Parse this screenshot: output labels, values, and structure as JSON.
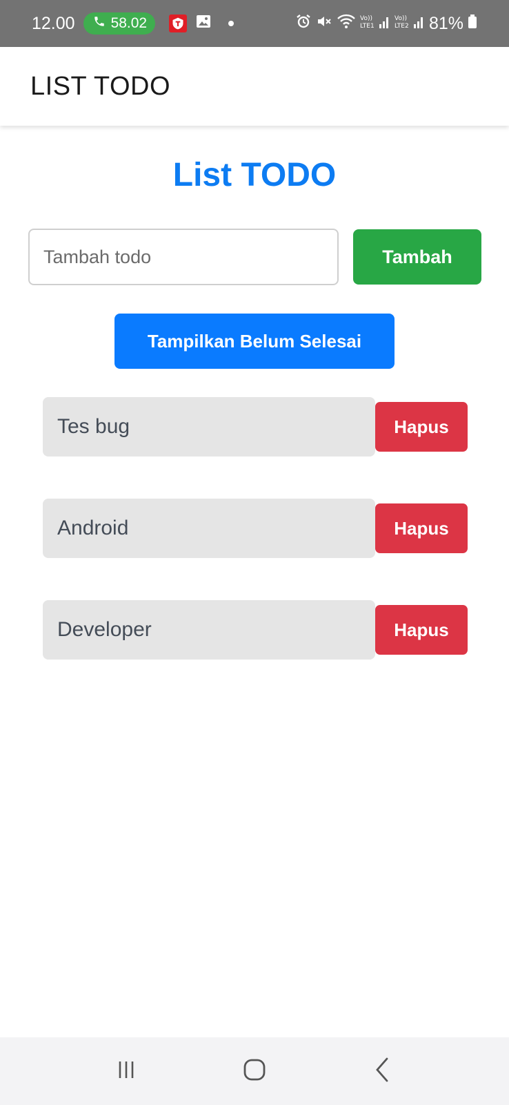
{
  "status_bar": {
    "time": "12.00",
    "call_timer": "58.02",
    "battery": "81%"
  },
  "app_bar": {
    "title": "LIST TODO"
  },
  "main": {
    "heading": "List TODO",
    "input_placeholder": "Tambah todo",
    "input_value": "",
    "add_button": "Tambah",
    "filter_button": "Tampilkan Belum Selesai",
    "todos": [
      {
        "text": "Tes bug",
        "delete_label": "Hapus"
      },
      {
        "text": "Android",
        "delete_label": "Hapus"
      },
      {
        "text": "Developer",
        "delete_label": "Hapus"
      }
    ]
  },
  "colors": {
    "heading": "#0d7cf2",
    "add_button": "#28a745",
    "filter_button": "#0a7bff",
    "delete_button": "#dc3545",
    "todo_item_bg": "#e5e5e5"
  },
  "icons": {
    "status": [
      "phone-icon",
      "app-notification-icon",
      "gallery-icon",
      "alarm-icon",
      "mute-icon",
      "wifi-icon",
      "signal-icon",
      "battery-icon"
    ],
    "nav": [
      "recent-apps-icon",
      "home-icon",
      "back-icon"
    ]
  }
}
